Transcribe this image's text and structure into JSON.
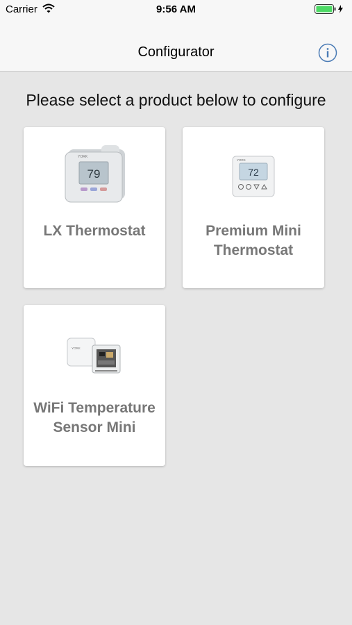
{
  "status_bar": {
    "carrier": "Carrier",
    "time": "9:56 AM"
  },
  "nav": {
    "title": "Configurator",
    "info_icon": "info-icon"
  },
  "heading": "Please select a product below to configure",
  "products": [
    {
      "name": "LX Thermostat",
      "display": "79",
      "brand": "YORK"
    },
    {
      "name": "Premium Mini Thermostat",
      "display": "72",
      "brand": "YORK"
    },
    {
      "name": "WiFi Temperature Sensor Mini",
      "brand": "YORK"
    }
  ],
  "colors": {
    "accent": "#4a7bb5",
    "label": "#777777",
    "background": "#e6e6e6",
    "battery": "#4cd964"
  }
}
